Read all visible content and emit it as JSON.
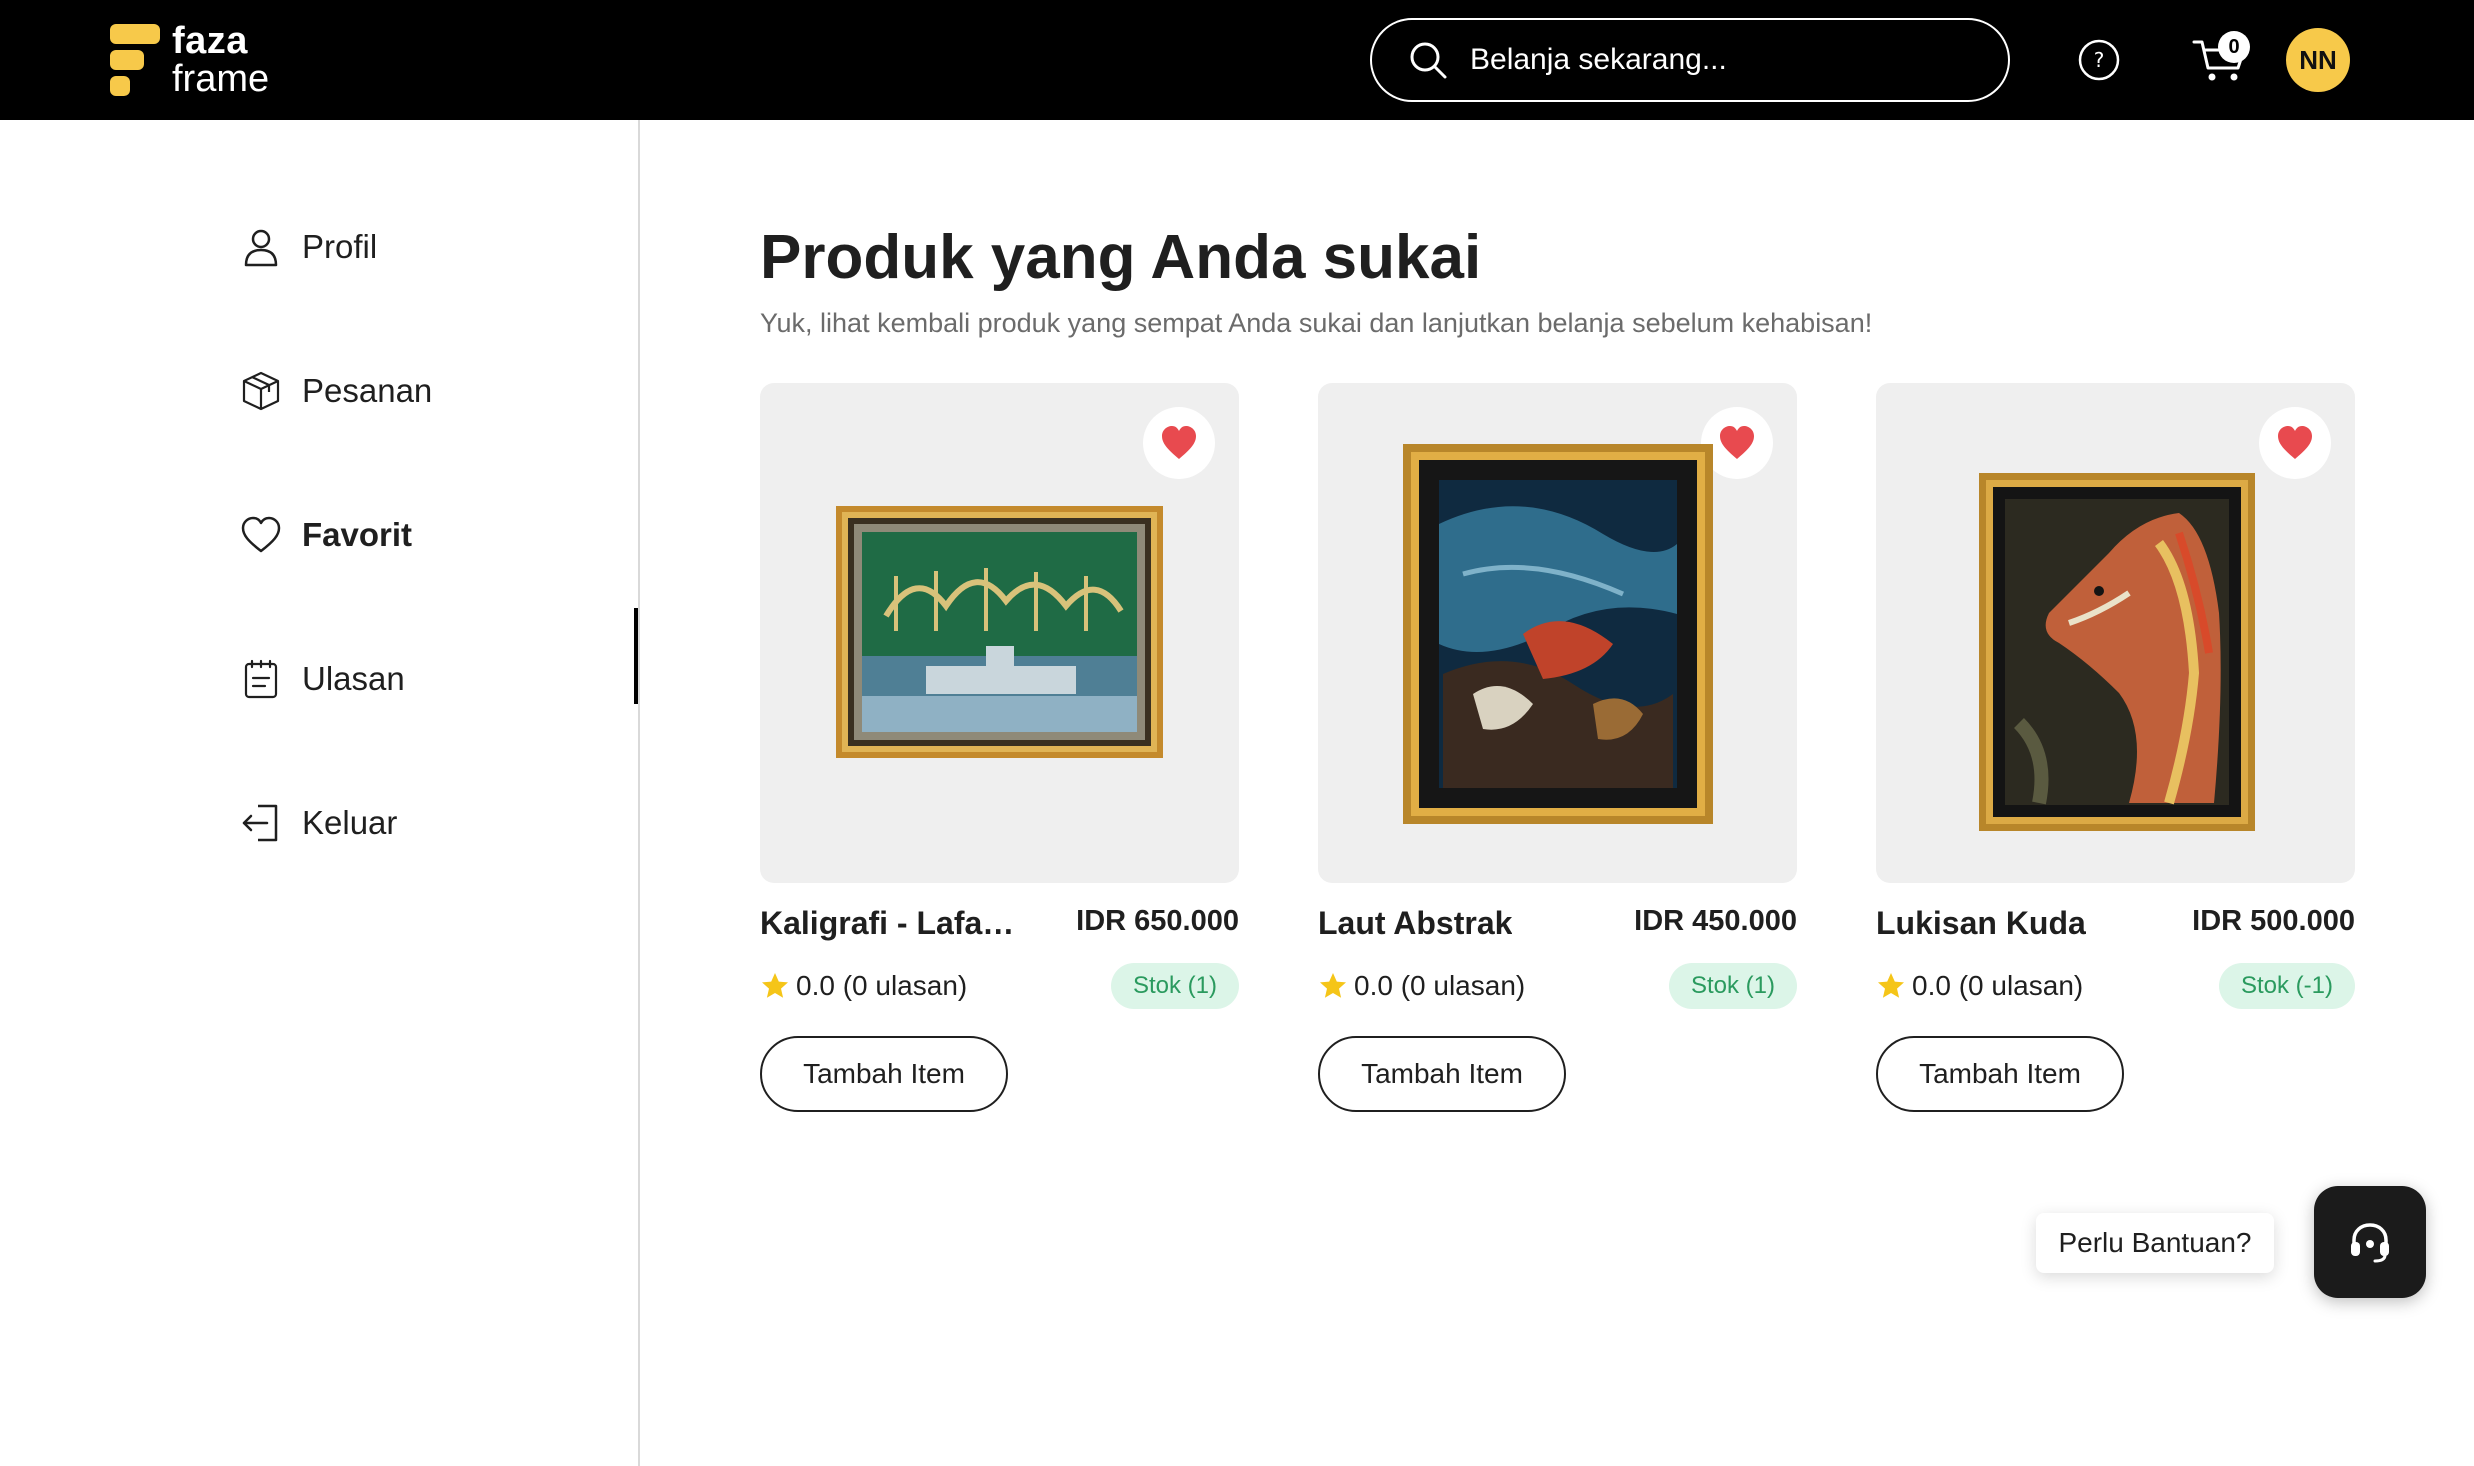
{
  "header": {
    "logo_line1": "faza",
    "logo_line2": "frame",
    "search_placeholder": "Belanja sekarang...",
    "cart_count": "0",
    "avatar_initials": "NN"
  },
  "sidebar": {
    "items": [
      {
        "label": "Profil",
        "icon": "user-icon"
      },
      {
        "label": "Pesanan",
        "icon": "box-icon"
      },
      {
        "label": "Favorit",
        "icon": "heart-icon",
        "active": true
      },
      {
        "label": "Ulasan",
        "icon": "clipboard-icon"
      },
      {
        "label": "Keluar",
        "icon": "logout-icon"
      }
    ]
  },
  "main": {
    "title": "Produk yang Anda sukai",
    "subtitle": "Yuk, lihat kembali produk yang sempat Anda sukai dan lanjutkan belanja sebelum kehabisan!"
  },
  "products": [
    {
      "name": "Kaligrafi - Lafaz ...",
      "price": "IDR 650.000",
      "rating": "0.0 (0 ulasan)",
      "stock": "Stok (1)",
      "button": "Tambah Item"
    },
    {
      "name": "Laut Abstrak",
      "price": "IDR 450.000",
      "rating": "0.0 (0 ulasan)",
      "stock": "Stok (1)",
      "button": "Tambah Item"
    },
    {
      "name": "Lukisan Kuda",
      "price": "IDR 500.000",
      "rating": "0.0 (0 ulasan)",
      "stock": "Stok (-1)",
      "button": "Tambah Item"
    }
  ],
  "help": {
    "label": "Perlu Bantuan?"
  },
  "colors": {
    "header_bg": "#000000",
    "logo_accent": "#f7c94a",
    "heart": "#e84a4f",
    "star": "#f5c518",
    "stock_bg": "#dcf5e8",
    "stock_text": "#2a9a5e"
  }
}
